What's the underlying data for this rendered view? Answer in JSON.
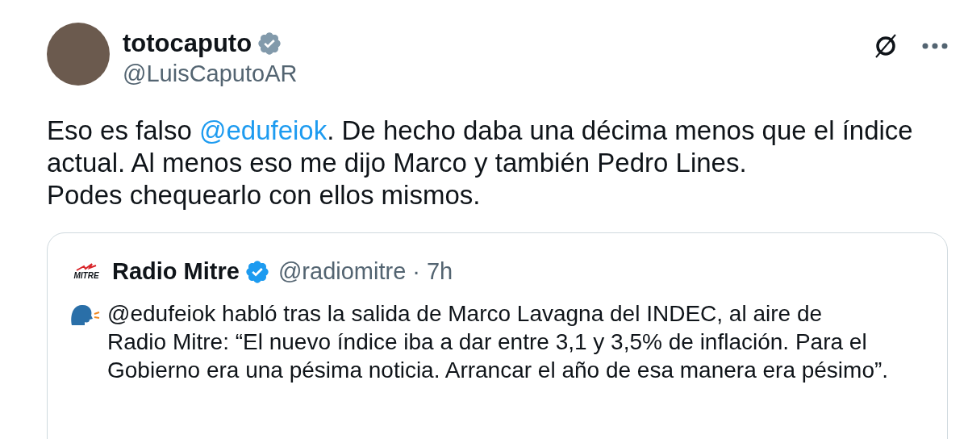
{
  "tweet": {
    "author": {
      "name": "totocaputo",
      "handle": "@LuisCaputoAR",
      "verified_badge": {
        "color": "#829aab"
      }
    },
    "body": [
      {
        "kind": "text",
        "text": "Eso es falso "
      },
      {
        "kind": "mention",
        "text": "@edufeiok"
      },
      {
        "kind": "text",
        "text": ". De hecho daba una décima menos que el índice\nactual. Al menos eso me dijo Marco y también Pedro Lines.\nPodes chequearlo con ellos mismos."
      }
    ],
    "quote": {
      "logo_text": "MITRE",
      "name": "Radio Mitre",
      "verified_badge": {
        "color": "#1d9bf0"
      },
      "handle": "@radiomitre",
      "separator": "·",
      "time": "7h",
      "text": "@edufeiok habló tras la salida de Marco Lavagna del INDEC, al aire de\nRadio Mitre: “El nuevo índice iba a dar entre 3,1 y 3,5% de inflación. Para el\nGobierno era una pésima noticia. Arrancar el año de esa manera era pésimo”."
    }
  }
}
